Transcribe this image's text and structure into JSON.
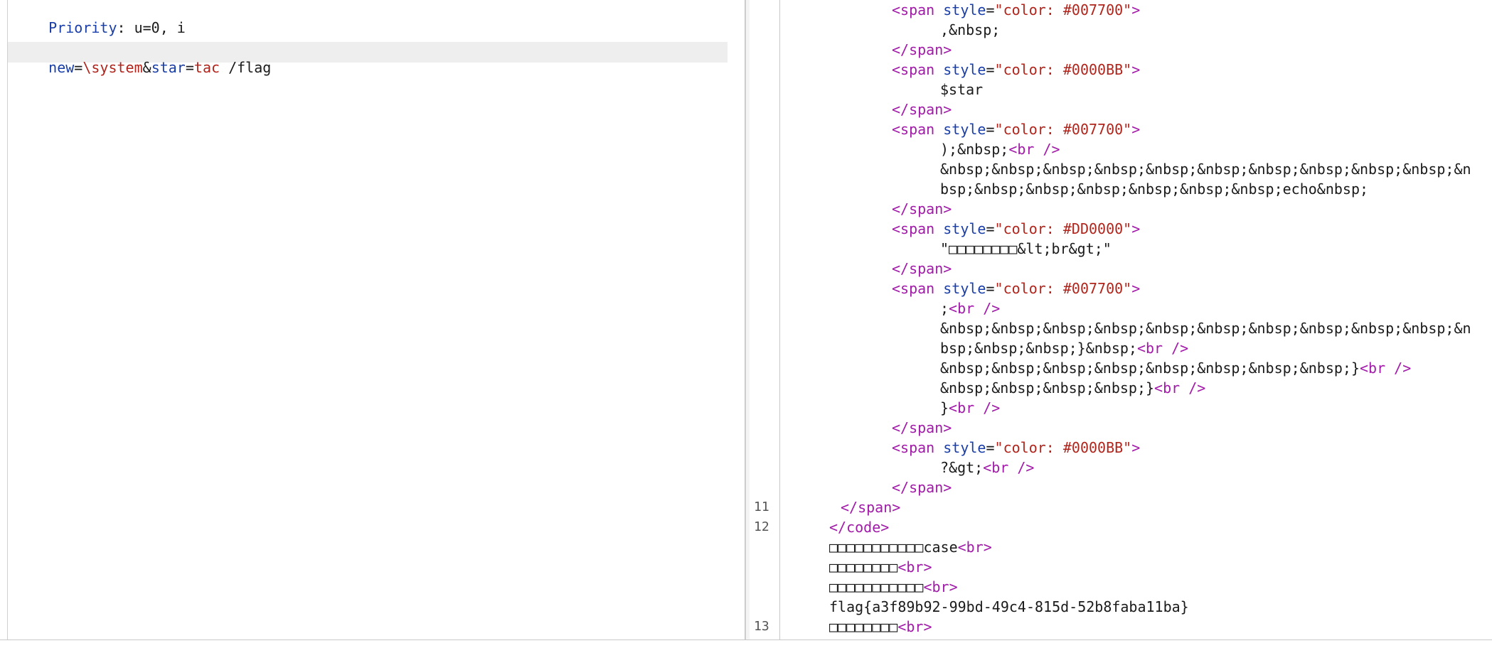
{
  "left_editor": {
    "line1": {
      "label": "Priority",
      "rest": ": u=0, i"
    },
    "line2": {
      "p1": "new",
      "p2": "=",
      "p3": "\\system",
      "p4": "&",
      "p5": "star",
      "p6": "=",
      "p7": "tac",
      "p8": " /flag"
    }
  },
  "right_editor": {
    "lines": [
      {
        "ln": "",
        "indent": 0,
        "parts": [
          [
            "tag",
            "<span"
          ],
          [
            "p",
            " "
          ],
          [
            "atr",
            "style"
          ],
          [
            "p",
            "="
          ],
          [
            "val",
            "\"color: #007700\""
          ],
          [
            "tag",
            ">"
          ]
        ]
      },
      {
        "ln": "",
        "indent": 1,
        "parts": [
          [
            "p",
            ",&nbsp;"
          ]
        ]
      },
      {
        "ln": "",
        "indent": 0,
        "parts": [
          [
            "tag",
            "</span>"
          ]
        ]
      },
      {
        "ln": "",
        "indent": 0,
        "parts": [
          [
            "tag",
            "<span"
          ],
          [
            "p",
            " "
          ],
          [
            "atr",
            "style"
          ],
          [
            "p",
            "="
          ],
          [
            "val",
            "\"color: #0000BB\""
          ],
          [
            "tag",
            ">"
          ]
        ]
      },
      {
        "ln": "",
        "indent": 1,
        "parts": [
          [
            "p",
            "$star"
          ]
        ]
      },
      {
        "ln": "",
        "indent": 0,
        "parts": [
          [
            "tag",
            "</span>"
          ]
        ]
      },
      {
        "ln": "",
        "indent": 0,
        "parts": [
          [
            "tag",
            "<span"
          ],
          [
            "p",
            " "
          ],
          [
            "atr",
            "style"
          ],
          [
            "p",
            "="
          ],
          [
            "val",
            "\"color: #007700\""
          ],
          [
            "tag",
            ">"
          ]
        ]
      },
      {
        "ln": "",
        "indent": 1,
        "parts": [
          [
            "p",
            ");&nbsp;"
          ],
          [
            "tag",
            "<br />"
          ]
        ]
      },
      {
        "ln": "",
        "indent": 1,
        "parts": [
          [
            "p",
            "&nbsp;&nbsp;&nbsp;&nbsp;&nbsp;&nbsp;&nbsp;&nbsp;&nbsp;&nbsp;&n"
          ]
        ]
      },
      {
        "ln": "",
        "indent": 1,
        "parts": [
          [
            "p",
            "bsp;&nbsp;&nbsp;&nbsp;&nbsp;&nbsp;&nbsp;echo&nbsp;"
          ]
        ]
      },
      {
        "ln": "",
        "indent": 0,
        "parts": [
          [
            "tag",
            "</span>"
          ]
        ]
      },
      {
        "ln": "",
        "indent": 0,
        "parts": [
          [
            "tag",
            "<span"
          ],
          [
            "p",
            " "
          ],
          [
            "atr",
            "style"
          ],
          [
            "p",
            "="
          ],
          [
            "val",
            "\"color: #DD0000\""
          ],
          [
            "tag",
            ">"
          ]
        ]
      },
      {
        "ln": "",
        "indent": 1,
        "parts": [
          [
            "p",
            "\"□□□□□□□□&lt;br&gt;\""
          ]
        ]
      },
      {
        "ln": "",
        "indent": 0,
        "parts": [
          [
            "tag",
            "</span>"
          ]
        ]
      },
      {
        "ln": "",
        "indent": 0,
        "parts": [
          [
            "tag",
            "<span"
          ],
          [
            "p",
            " "
          ],
          [
            "atr",
            "style"
          ],
          [
            "p",
            "="
          ],
          [
            "val",
            "\"color: #007700\""
          ],
          [
            "tag",
            ">"
          ]
        ]
      },
      {
        "ln": "",
        "indent": 1,
        "parts": [
          [
            "p",
            ";"
          ],
          [
            "tag",
            "<br />"
          ]
        ]
      },
      {
        "ln": "",
        "indent": 1,
        "parts": [
          [
            "p",
            "&nbsp;&nbsp;&nbsp;&nbsp;&nbsp;&nbsp;&nbsp;&nbsp;&nbsp;&nbsp;&n"
          ]
        ]
      },
      {
        "ln": "",
        "indent": 1,
        "parts": [
          [
            "p",
            "bsp;&nbsp;&nbsp;}&nbsp;"
          ],
          [
            "tag",
            "<br />"
          ]
        ]
      },
      {
        "ln": "",
        "indent": 1,
        "parts": [
          [
            "p",
            "&nbsp;&nbsp;&nbsp;&nbsp;&nbsp;&nbsp;&nbsp;&nbsp;}"
          ],
          [
            "tag",
            "<br />"
          ]
        ]
      },
      {
        "ln": "",
        "indent": 1,
        "parts": [
          [
            "p",
            "&nbsp;&nbsp;&nbsp;&nbsp;}"
          ],
          [
            "tag",
            "<br />"
          ]
        ]
      },
      {
        "ln": "",
        "indent": 1,
        "parts": [
          [
            "p",
            "}"
          ],
          [
            "tag",
            "<br />"
          ]
        ]
      },
      {
        "ln": "",
        "indent": 0,
        "parts": [
          [
            "tag",
            "</span>"
          ]
        ]
      },
      {
        "ln": "",
        "indent": 0,
        "parts": [
          [
            "tag",
            "<span"
          ],
          [
            "p",
            " "
          ],
          [
            "atr",
            "style"
          ],
          [
            "p",
            "="
          ],
          [
            "val",
            "\"color: #0000BB\""
          ],
          [
            "tag",
            ">"
          ]
        ]
      },
      {
        "ln": "",
        "indent": 1,
        "parts": [
          [
            "p",
            "?&gt;"
          ],
          [
            "tag",
            "<br />"
          ]
        ]
      },
      {
        "ln": "",
        "indent": 0,
        "parts": [
          [
            "tag",
            "</span>"
          ]
        ]
      },
      {
        "ln": "11",
        "indent": -1,
        "parts": [
          [
            "tag",
            "</span>"
          ]
        ]
      },
      {
        "ln": "12",
        "indent": -2,
        "parts": [
          [
            "tag",
            "</code>"
          ]
        ]
      },
      {
        "ln": "",
        "indent": -2,
        "parts": [
          [
            "p",
            "□□□□□□□□□□□case"
          ],
          [
            "tag",
            "<br>"
          ]
        ]
      },
      {
        "ln": "",
        "indent": -2,
        "parts": [
          [
            "p",
            "□□□□□□□□"
          ],
          [
            "tag",
            "<br>"
          ]
        ]
      },
      {
        "ln": "",
        "indent": -2,
        "parts": [
          [
            "p",
            "□□□□□□□□□□□"
          ],
          [
            "tag",
            "<br>"
          ]
        ]
      },
      {
        "ln": "",
        "indent": -2,
        "parts": [
          [
            "p",
            "flag{a3f89b92-99bd-49c4-815d-52b8faba11ba}"
          ]
        ]
      },
      {
        "ln": "13",
        "indent": -2,
        "parts": [
          [
            "p",
            "□□□□□□□□"
          ],
          [
            "tag",
            "<br>"
          ]
        ]
      }
    ]
  }
}
